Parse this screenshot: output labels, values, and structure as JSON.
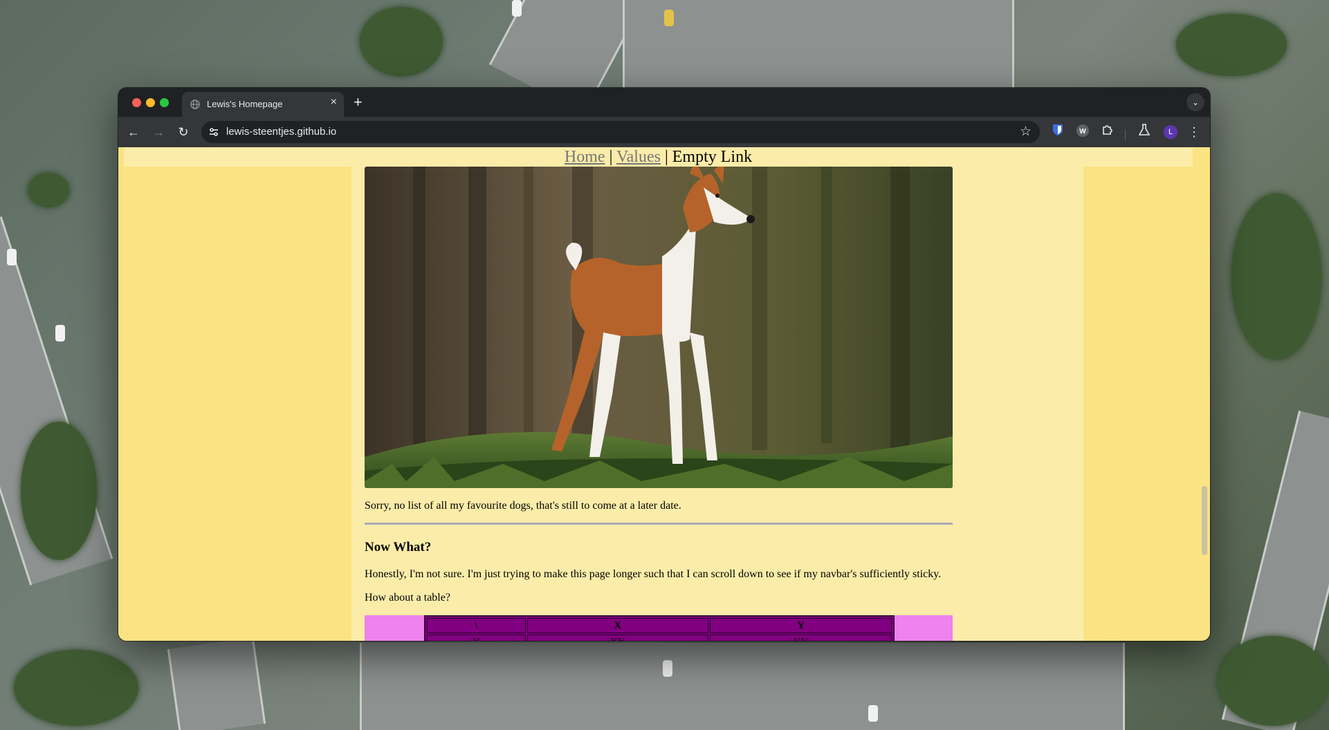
{
  "browser": {
    "tab_title": "Lewis's Homepage",
    "tab_close_label": "×",
    "new_tab_label": "+",
    "url": "lewis-steentjes.github.io"
  },
  "toolbar_icons": [
    "back-icon",
    "forward-icon",
    "reload-icon",
    "site-info-icon",
    "bookmark-star-icon",
    "bitwarden-icon",
    "wordtune-icon",
    "extensions-icon",
    "labs-icon",
    "profile-avatar",
    "more-menu-icon"
  ],
  "profile_initial": "L",
  "page": {
    "navbar": {
      "home": "Home",
      "separator": "|",
      "values": "Values",
      "empty_link": "Empty Link"
    },
    "paragraph_dogs": "Sorry, no list of all my favourite dogs, that's still to come at a later date.",
    "heading_now_what": "Now What?",
    "paragraph_honestly": "Honestly, I'm not sure. I'm just trying to make this page longer such that I can scroll down to see if my navbar's sufficiently sticky.",
    "paragraph_table": "How about a table?",
    "table": {
      "headers": [
        "\\",
        "X",
        "Y"
      ],
      "row1": [
        "Y",
        "XY",
        "YY"
      ]
    }
  },
  "colors": {
    "page_bg": "#fae382",
    "content_bg": "#fbeca9",
    "table_outer": "#ee82ee",
    "table_inner": "#800080"
  }
}
